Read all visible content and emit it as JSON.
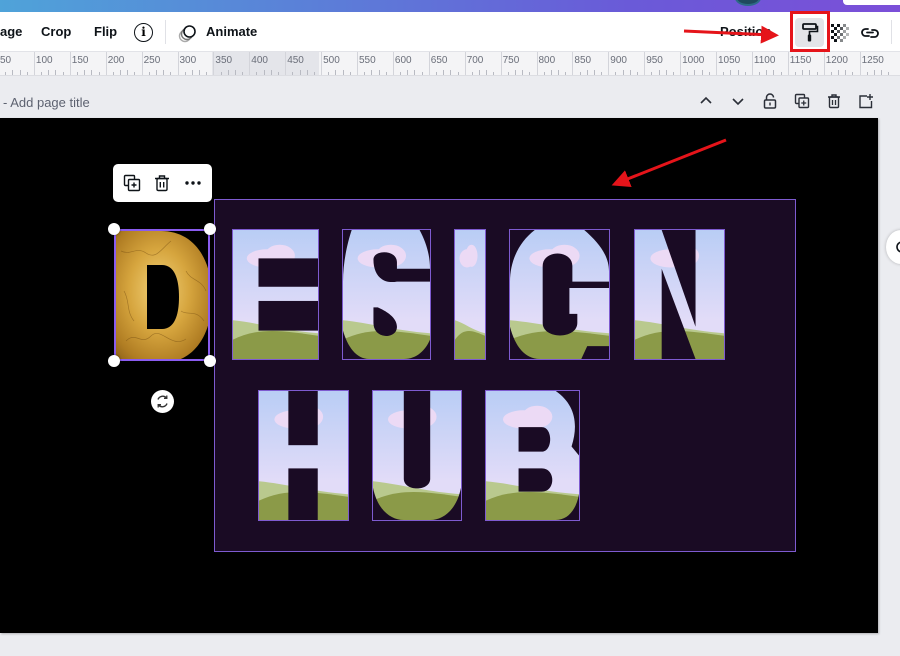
{
  "toolbar": {
    "items": [
      {
        "label": "age",
        "name": "edit-image-button"
      },
      {
        "label": "Crop",
        "name": "crop-button"
      },
      {
        "label": "Flip",
        "name": "flip-button"
      }
    ],
    "info_label": "i",
    "animate_label": "Animate",
    "position_label": "Position",
    "paint_format_icon": "paint-roller-icon",
    "transparency_icon": "checkerboard-icon",
    "link_icon": "link-icon"
  },
  "ruler": {
    "ticks": [
      "50",
      "100",
      "150",
      "200",
      "250",
      "300",
      "350",
      "400",
      "450",
      "500",
      "550",
      "600",
      "650",
      "700",
      "750",
      "800",
      "850",
      "900",
      "950",
      "1000",
      "1050",
      "1100",
      "1150",
      "1200",
      "1250"
    ]
  },
  "page_header": {
    "title_placeholder": "- Add page title",
    "actions": [
      "move-up",
      "move-down",
      "lock",
      "duplicate",
      "delete",
      "add-page"
    ]
  },
  "element_menu": {
    "actions": [
      "duplicate",
      "delete",
      "more"
    ]
  },
  "canvas": {
    "background": "#000000",
    "group_background": "#1a0b24",
    "selection_color": "#8a5cf0",
    "word1": [
      "D",
      "E",
      "S",
      "I",
      "G",
      "N"
    ],
    "word2": [
      "H",
      "U",
      "B"
    ],
    "selected_letter": "D",
    "selected_fill": "gold-foil",
    "other_fill": "sky-landscape"
  },
  "annotations": {
    "color": "#e5141a",
    "arrows": [
      "arrow-to-paint-format",
      "arrow-to-group"
    ]
  }
}
